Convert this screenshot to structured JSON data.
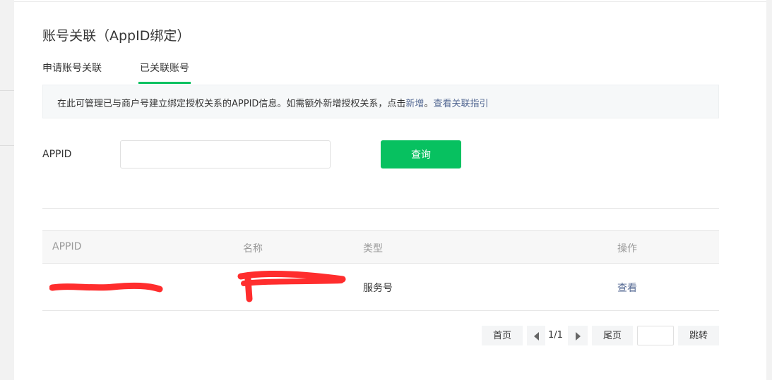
{
  "page": {
    "title": "账号关联（AppID绑定）"
  },
  "tabs": [
    {
      "label": "申请账号关联"
    },
    {
      "label": "已关联账号"
    }
  ],
  "notice": {
    "text": "在此可管理已与商户号建立绑定授权关系的APPID信息。如需额外新增授权关系，点击",
    "link_add": "新增",
    "separator": "。",
    "link_guide": "查看关联指引"
  },
  "filter": {
    "label": "APPID",
    "input_value": "",
    "button_label": "查询"
  },
  "table": {
    "columns": [
      "APPID",
      "名称",
      "类型",
      "操作"
    ],
    "rows": [
      {
        "type": "服务号",
        "action": "查看"
      }
    ]
  },
  "pagination": {
    "first": "首页",
    "page_indicator": "1/1",
    "last": "尾页",
    "jump_value": "",
    "jump": "跳转"
  },
  "colors": {
    "accent": "#07c160",
    "link": "#576b95",
    "redaction": "#ff2d2d"
  }
}
